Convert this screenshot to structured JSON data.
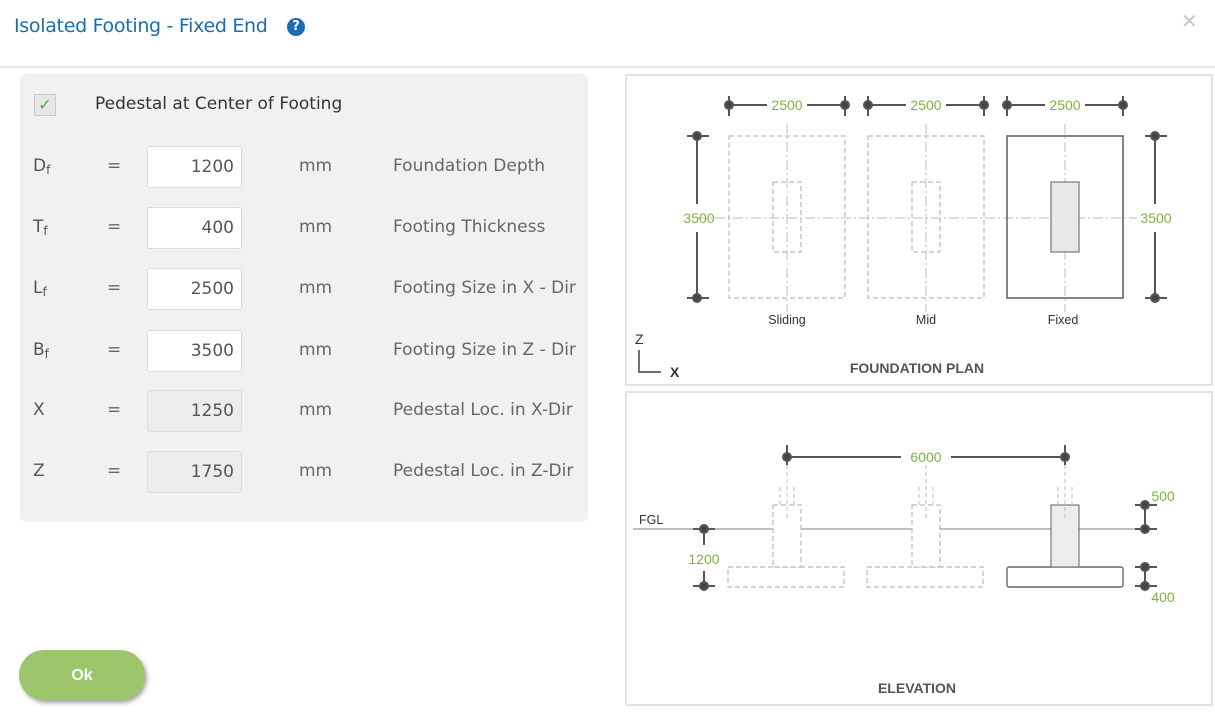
{
  "header": {
    "title": "Isolated Footing - Fixed End",
    "help_icon": "question-circle-icon",
    "close_icon": "close-x-icon"
  },
  "form": {
    "checkbox": {
      "label": "Pedestal at Center of Footing",
      "checked": true,
      "glyph": "✓"
    },
    "fields": [
      {
        "symbol": "D",
        "sub": "f",
        "eq": "=",
        "value": "1200",
        "unit": "mm",
        "description": "Foundation Depth",
        "readonly": false
      },
      {
        "symbol": "T",
        "sub": "f",
        "eq": "=",
        "value": "400",
        "unit": "mm",
        "description": "Footing Thickness",
        "readonly": false
      },
      {
        "symbol": "L",
        "sub": "f",
        "eq": "=",
        "value": "2500",
        "unit": "mm",
        "description": "Footing Size in X - Dir",
        "readonly": false
      },
      {
        "symbol": "B",
        "sub": "f",
        "eq": "=",
        "value": "3500",
        "unit": "mm",
        "description": "Footing Size in Z - Dir",
        "readonly": false
      },
      {
        "symbol": "X",
        "sub": "",
        "eq": "=",
        "value": "1250",
        "unit": "mm",
        "description": "Pedestal Loc. in X-Dir",
        "readonly": true
      },
      {
        "symbol": "Z",
        "sub": "",
        "eq": "=",
        "value": "1750",
        "unit": "mm",
        "description": "Pedestal Loc. in Z-Dir",
        "readonly": true
      }
    ]
  },
  "footer": {
    "ok_label": "Ok"
  },
  "plan": {
    "title": "FOUNDATION PLAN",
    "width_dims": [
      "2500",
      "2500",
      "2500"
    ],
    "height_dim_left": "3500",
    "height_dim_right": "3500",
    "labels": [
      "Sliding",
      "Mid",
      "Fixed"
    ],
    "axis_z": "Z",
    "axis_x": "X"
  },
  "elevation": {
    "title": "ELEVATION",
    "span_dim": "6000",
    "fgl_label": "FGL",
    "depth_dim": "1200",
    "pedestal_dim": "500",
    "thickness_dim": "400"
  },
  "colors": {
    "accent": "#1a6db3",
    "dim_text": "#7cb342",
    "ok_button": "#9dc66c",
    "check": "#5aa63c"
  }
}
